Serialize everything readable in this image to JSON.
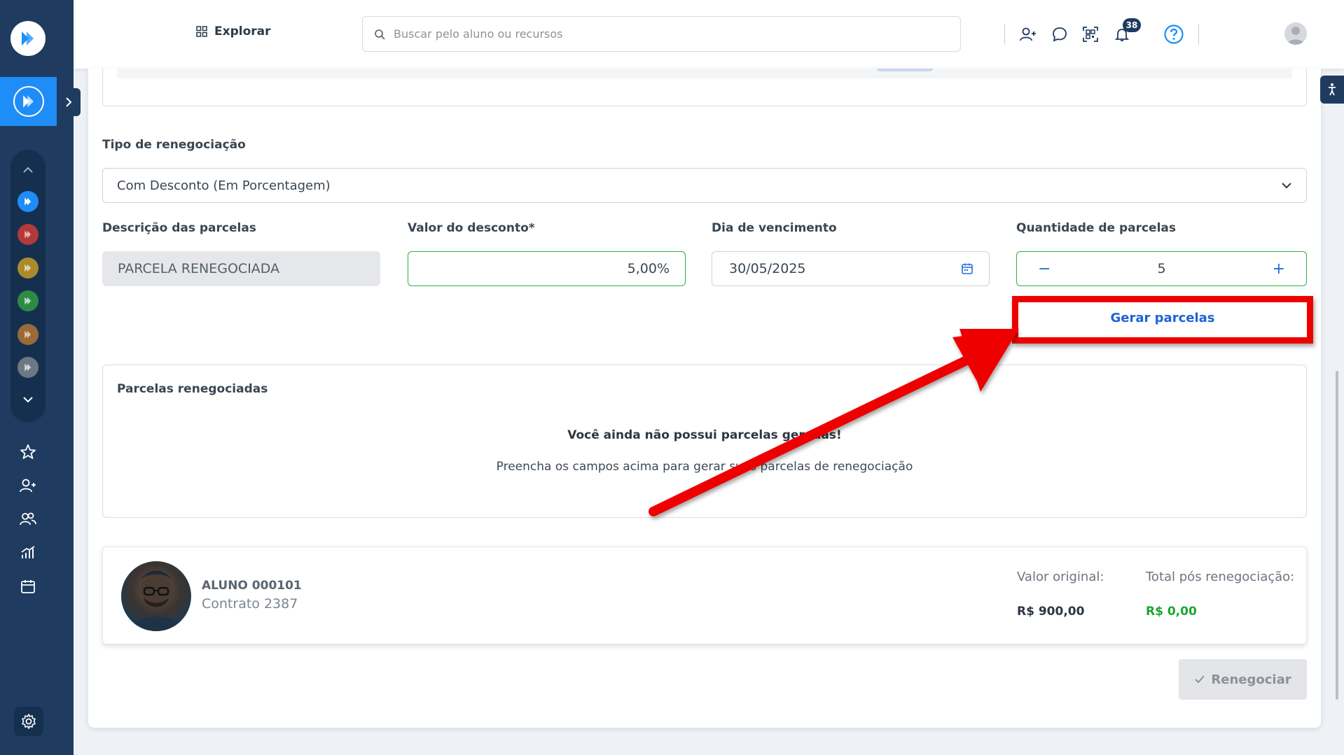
{
  "header": {
    "explore_label": "Explorar",
    "search_placeholder": "Buscar pelo aluno ou recursos",
    "notification_count": "38"
  },
  "form": {
    "tipo_label": "Tipo de renegociação",
    "tipo_value": "Com Desconto (Em Porcentagem)",
    "descricao_label": "Descrição das parcelas",
    "descricao_value": "PARCELA RENEGOCIADA",
    "desconto_label": "Valor do desconto*",
    "desconto_value": "5,00%",
    "vencimento_label": "Dia de vencimento",
    "vencimento_value": "30/05/2025",
    "quantidade_label": "Quantidade de parcelas",
    "quantidade_value": "5",
    "minus_symbol": "−",
    "plus_symbol": "+",
    "gerar_label": "Gerar parcelas"
  },
  "parcelas": {
    "title": "Parcelas renegociadas",
    "empty_title": "Você ainda não possui parcelas geradas!",
    "empty_subtitle": "Preencha os campos acima para gerar suas parcelas de renegociação"
  },
  "aluno": {
    "name": "ALUNO 000101",
    "contract": "Contrato 2387",
    "original_label": "Valor original:",
    "original_value": "R$ 900,00",
    "total_label": "Total pós renegociação:",
    "total_value": "R$ 0,00"
  },
  "actions": {
    "renegociar_label": "Renegociar"
  },
  "colors": {
    "sidebar": "#1f3b5f",
    "accent_blue": "#1e8df7",
    "valid_green": "#2fae44",
    "total_green": "#1aa531",
    "highlight_red": "#ee0000"
  }
}
